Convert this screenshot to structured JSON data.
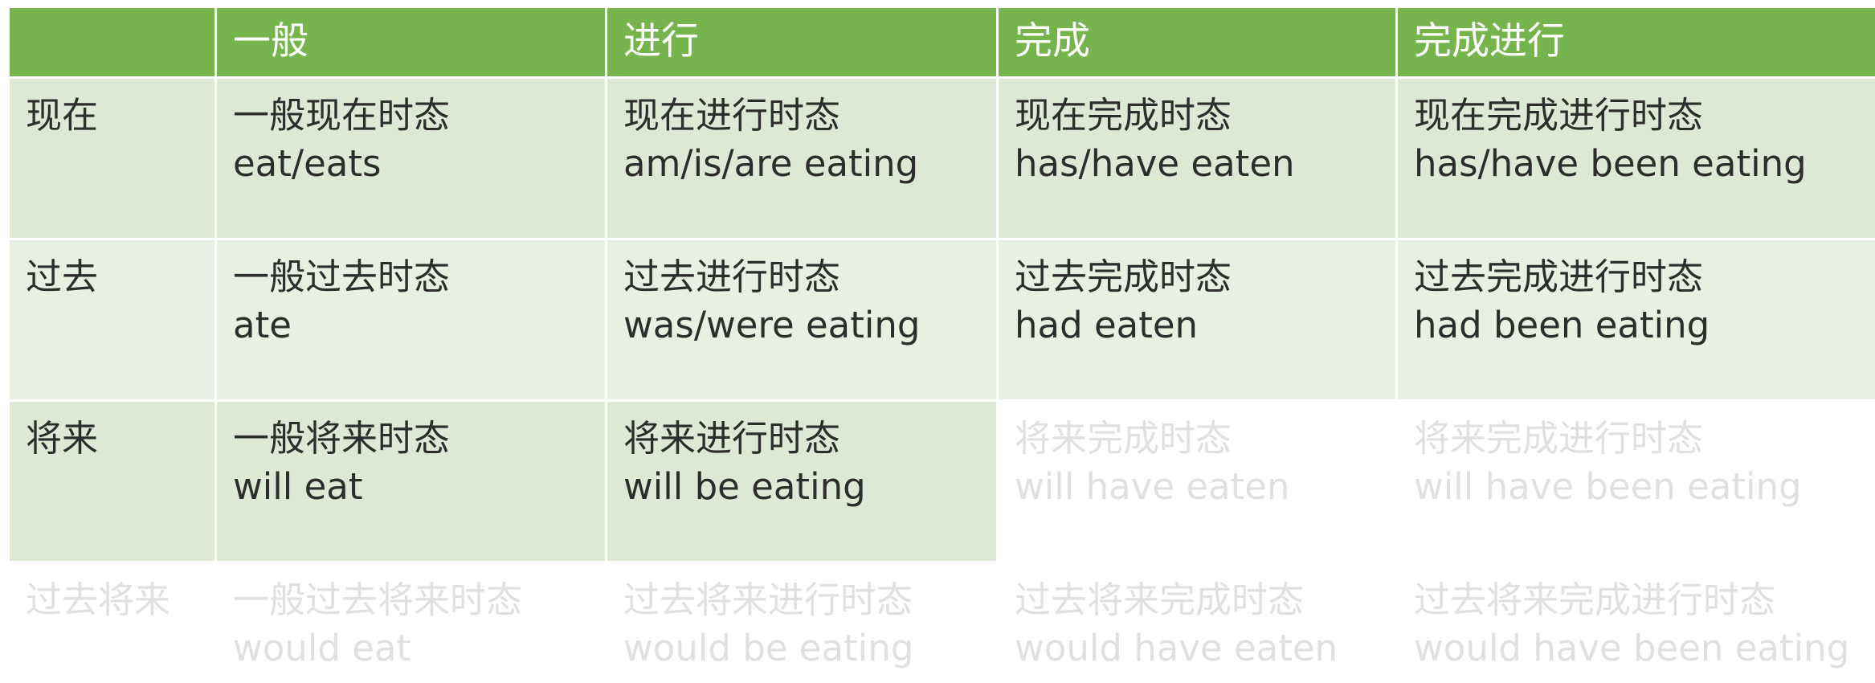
{
  "table": {
    "header": [
      "",
      "一般",
      "进行",
      "完成",
      "完成进行"
    ],
    "rows": [
      {
        "label": "现在",
        "cells": [
          {
            "name": "一般现在时态",
            "form": "eat/eats"
          },
          {
            "name": "现在进行时态",
            "form": "am/is/are eating"
          },
          {
            "name": "现在完成时态",
            "form": "has/have eaten"
          },
          {
            "name": "现在完成进行时态",
            "form": "has/have been eating"
          }
        ]
      },
      {
        "label": "过去",
        "cells": [
          {
            "name": "一般过去时态",
            "form": "ate"
          },
          {
            "name": "过去进行时态",
            "form": "was/were eating"
          },
          {
            "name": "过去完成时态",
            "form": "had eaten"
          },
          {
            "name": "过去完成进行时态",
            "form": "had been eating"
          }
        ]
      },
      {
        "label": "将来",
        "cells": [
          {
            "name": "一般将来时态",
            "form": "will eat"
          },
          {
            "name": "将来进行时态",
            "form": "will be eating"
          },
          {
            "name": "将来完成时态",
            "form": "will have eaten"
          },
          {
            "name": "将来完成进行时态",
            "form": "will have been eating"
          }
        ]
      },
      {
        "label": "过去将来",
        "cells": [
          {
            "name": "一般过去将来时态",
            "form": "would eat"
          },
          {
            "name": "过去将来进行时态",
            "form": "would be eating"
          },
          {
            "name": "过去将来完成时态",
            "form": "would have eaten"
          },
          {
            "name": "过去将来完成进行时态",
            "form": "would have been eating"
          }
        ]
      }
    ]
  },
  "colors": {
    "header_green": "#78b44e",
    "cell_green_dark": "#dde8d6",
    "cell_green_light": "#e8f0e3",
    "faded_text": "#e0e0e0"
  }
}
